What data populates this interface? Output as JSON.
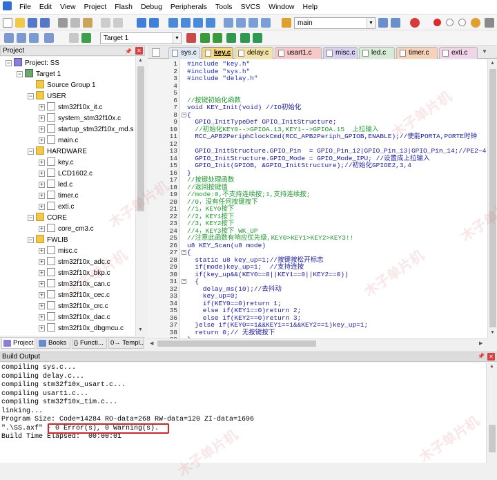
{
  "menu": [
    "File",
    "Edit",
    "View",
    "Project",
    "Flash",
    "Debug",
    "Peripherals",
    "Tools",
    "SVCS",
    "Window",
    "Help"
  ],
  "toolbar": {
    "search_combo": "main",
    "target_combo": "Target 1"
  },
  "project_panel": {
    "title": "Project",
    "root": "Project: SS",
    "target": "Target 1",
    "groups": [
      {
        "name": "Source Group 1",
        "files": []
      },
      {
        "name": "USER",
        "files": [
          "stm32f10x_it.c",
          "system_stm32f10x.c",
          "startup_stm32f10x_md.s",
          "main.c"
        ]
      },
      {
        "name": "HARDWARE",
        "files": [
          "key.c",
          "LCD1602.c",
          "led.c",
          "timer.c",
          "exti.c"
        ]
      },
      {
        "name": "CORE",
        "files": [
          "core_cm3.c"
        ]
      },
      {
        "name": "FWLIB",
        "files": [
          "misc.c",
          "stm32f10x_adc.c",
          "stm32f10x_bkp.c",
          "stm32f10x_can.c",
          "stm32f10x_cec.c",
          "stm32f10x_crc.c",
          "stm32f10x_dac.c",
          "stm32f10x_dbgmcu.c"
        ]
      }
    ],
    "bottom_tabs": [
      "Project",
      "Books",
      "{} Functi...",
      "0→ Templ..."
    ]
  },
  "file_tabs": [
    "sys.c",
    "key.c",
    "delay.c",
    "usart1.c",
    "misc.c",
    "led.c",
    "timer.c",
    "exti.c"
  ],
  "active_tab": "key.c",
  "code_lines": [
    {
      "n": "1",
      "t": "#include \"key.h\"",
      "k": "pre"
    },
    {
      "n": "2",
      "t": "#include \"sys.h\"",
      "k": "pre"
    },
    {
      "n": "3",
      "t": "#include \"delay.h\"",
      "k": "pre"
    },
    {
      "n": "4",
      "t": "",
      "k": "txt"
    },
    {
      "n": "5",
      "t": "",
      "k": "txt"
    },
    {
      "n": "6",
      "t": "//按键初始化函数",
      "k": "com"
    },
    {
      "n": "7",
      "t": "void KEY_Init(void) //IO初始化",
      "k": "mix"
    },
    {
      "n": "8",
      "t": "{",
      "k": "txt"
    },
    {
      "n": "9",
      "t": "  GPIO_InitTypeDef GPIO_InitStructure;",
      "k": "txt"
    },
    {
      "n": "10",
      "t": "  //初始化KEY0-->GPIOA.13,KEY1-->GPIOA.15  上拉输入",
      "k": "com"
    },
    {
      "n": "11",
      "t": "  RCC_APB2PeriphClockCmd(RCC_APB2Periph_GPIOB,ENABLE);//使能PORTA,PORTE时钟",
      "k": "mix"
    },
    {
      "n": "12",
      "t": "",
      "k": "txt"
    },
    {
      "n": "13",
      "t": "  GPIO_InitStructure.GPIO_Pin  = GPIO_Pin_12|GPIO_Pin_13|GPIO_Pin_14;//PE2~4",
      "k": "mix"
    },
    {
      "n": "14",
      "t": "  GPIO_InitStructure.GPIO_Mode = GPIO_Mode_IPU; //设置成上拉输入",
      "k": "mix"
    },
    {
      "n": "15",
      "t": "  GPIO_Init(GPIOB, &GPIO_InitStructure);//初始化GPIOE2,3,4",
      "k": "mix"
    },
    {
      "n": "16",
      "t": "}",
      "k": "txt"
    },
    {
      "n": "17",
      "t": "//按键处理函数",
      "k": "com"
    },
    {
      "n": "18",
      "t": "//返回按键值",
      "k": "com"
    },
    {
      "n": "19",
      "t": "//mode:0,不支持连续按;1,支持连续按;",
      "k": "com"
    },
    {
      "n": "20",
      "t": "//0，没有任何按键按下",
      "k": "com"
    },
    {
      "n": "21",
      "t": "//1，KEY0按下",
      "k": "com"
    },
    {
      "n": "22",
      "t": "//2，KEY1按下",
      "k": "com"
    },
    {
      "n": "23",
      "t": "//3，KEY2按下",
      "k": "com"
    },
    {
      "n": "24",
      "t": "//4，KEY3按下 WK_UP",
      "k": "com"
    },
    {
      "n": "25",
      "t": "//注意此函数有响应优先级,KEY0>KEY1>KEY2>KEY3!!",
      "k": "com"
    },
    {
      "n": "26",
      "t": "u8 KEY_Scan(u8 mode)",
      "k": "txt"
    },
    {
      "n": "27",
      "t": "{",
      "k": "txt"
    },
    {
      "n": "28",
      "t": "  static u8 key_up=1;//按键按松开标志",
      "k": "mix"
    },
    {
      "n": "29",
      "t": "  if(mode)key_up=1;  //支持连按",
      "k": "mix"
    },
    {
      "n": "30",
      "t": "  if(key_up&&(KEY0==0||KEY1==0||KEY2==0))",
      "k": "txt"
    },
    {
      "n": "31",
      "t": "  {",
      "k": "txt"
    },
    {
      "n": "32",
      "t": "    delay_ms(10);//去抖动",
      "k": "mix"
    },
    {
      "n": "33",
      "t": "    key_up=0;",
      "k": "txt"
    },
    {
      "n": "34",
      "t": "    if(KEY0==0)return 1;",
      "k": "txt"
    },
    {
      "n": "35",
      "t": "    else if(KEY1==0)return 2;",
      "k": "txt"
    },
    {
      "n": "36",
      "t": "    else if(KEY2==0)return 3;",
      "k": "txt"
    },
    {
      "n": "37",
      "t": "  }else if(KEY0==1&&KEY1==1&&KEY2==1)key_up=1;",
      "k": "txt"
    },
    {
      "n": "38",
      "t": "  return 0;// 无按键按下",
      "k": "mix"
    },
    {
      "n": "39",
      "t": "}",
      "k": "txt"
    }
  ],
  "build_output": {
    "title": "Build Output",
    "lines": [
      "compiling sys.c...",
      "compiling delay.c...",
      "compiling stm32f10x_usart.c...",
      "compiling usart1.c...",
      "compiling stm32f10x_tim.c...",
      "linking...",
      "Program Size: Code=14284 RO-data=268 RW-data=120 ZI-data=1696",
      "\".\\SS.axf\" - 0 Error(s), 0 Warning(s).",
      "Build Time Elapsed:  00:00:01"
    ],
    "highlight": "0 Error(s), 0 Warning(s)"
  },
  "watermark": "木子单片机",
  "colors": {
    "highlight_box": "#e02020",
    "active_tab": "#f6d97a"
  }
}
